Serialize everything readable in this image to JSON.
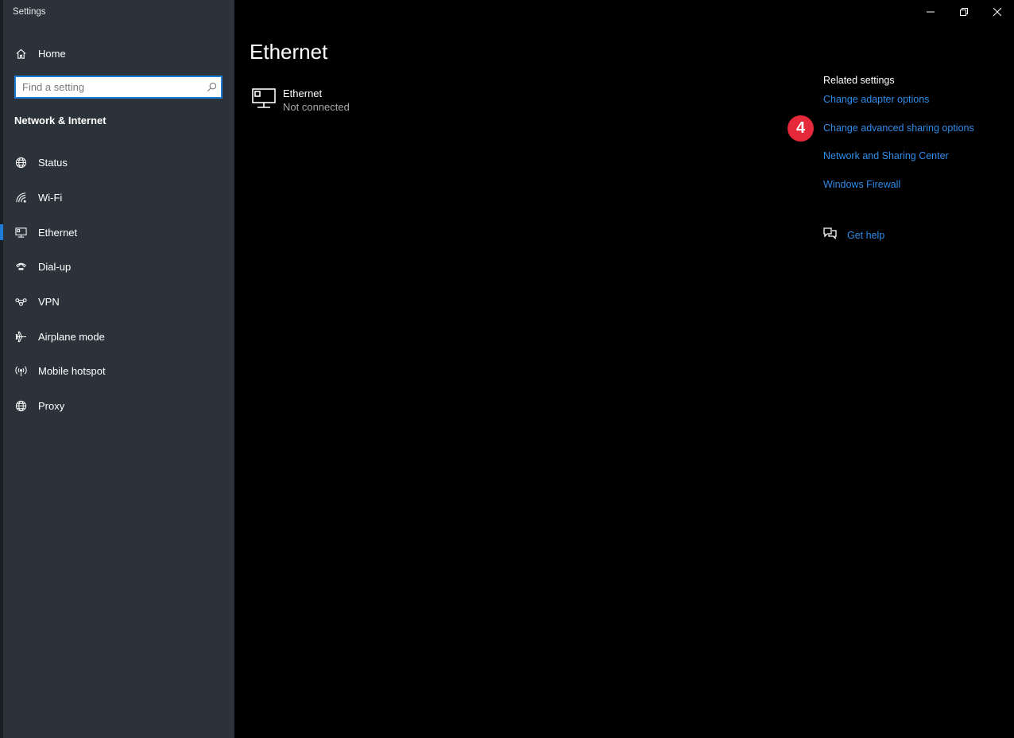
{
  "window": {
    "title": "Settings"
  },
  "sidebar": {
    "home_label": "Home",
    "search_placeholder": "Find a setting",
    "section_title": "Network & Internet",
    "items": [
      {
        "label": "Status",
        "icon": "globe-status-icon"
      },
      {
        "label": "Wi-Fi",
        "icon": "wifi-icon"
      },
      {
        "label": "Ethernet",
        "icon": "ethernet-icon",
        "selected": true
      },
      {
        "label": "Dial-up",
        "icon": "dialup-icon"
      },
      {
        "label": "VPN",
        "icon": "vpn-icon"
      },
      {
        "label": "Airplane mode",
        "icon": "airplane-icon"
      },
      {
        "label": "Mobile hotspot",
        "icon": "hotspot-icon"
      },
      {
        "label": "Proxy",
        "icon": "globe-icon"
      }
    ]
  },
  "main": {
    "title": "Ethernet",
    "connection": {
      "name": "Ethernet",
      "status": "Not connected"
    }
  },
  "related": {
    "title": "Related settings",
    "links": [
      "Change adapter options",
      "Change advanced sharing options",
      "Network and Sharing Center",
      "Windows Firewall"
    ],
    "help_label": "Get help"
  },
  "annotation": {
    "step": "4"
  },
  "colors": {
    "accent": "#1e7bd6",
    "link": "#2f8ce8",
    "badge": "#e5293a",
    "sidebar": "#2b323a"
  }
}
